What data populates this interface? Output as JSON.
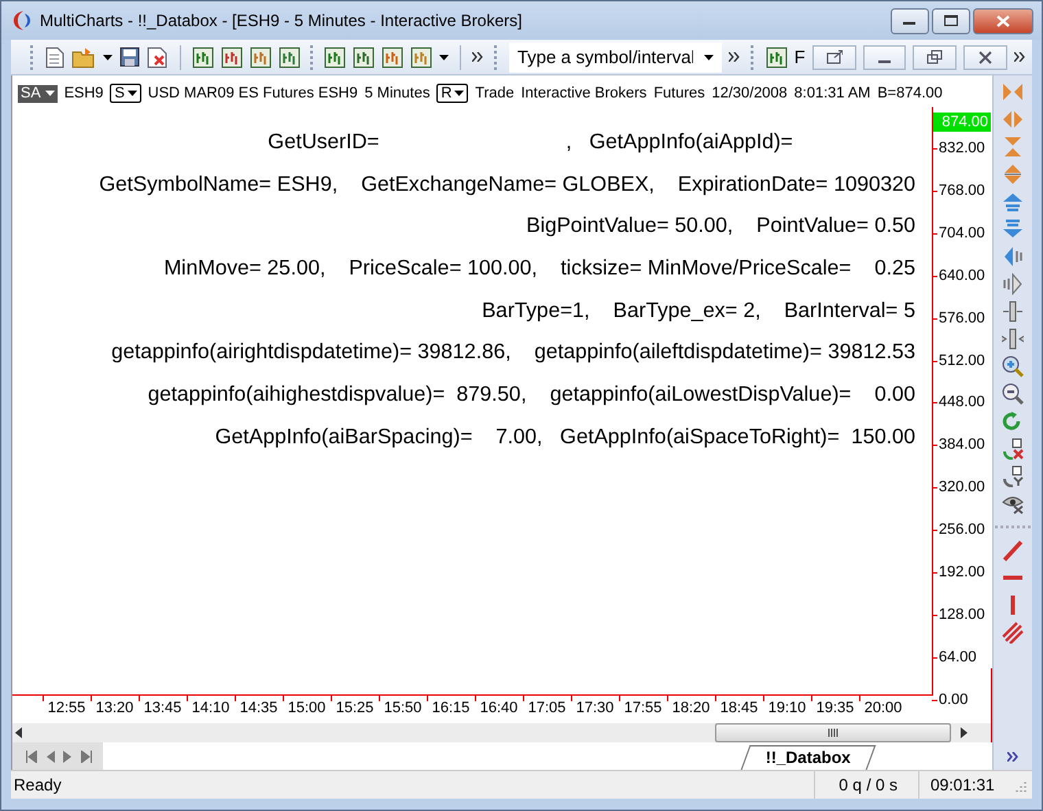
{
  "window": {
    "title": "MultiCharts - !!_Databox - [ESH9 - 5 Minutes - Interactive Brokers]"
  },
  "toolbar": {
    "symbol_field": {
      "placeholder": "Type a symbol/interval"
    },
    "f_label": "F"
  },
  "chart_header": {
    "data_series": "SA",
    "symbol": "ESH9",
    "s_button": "S",
    "description": "USD MAR09 ES Futures ESH9",
    "interval": "5 Minutes",
    "r_button": "R",
    "fields": [
      "Trade",
      "Interactive Brokers",
      "Futures",
      "12/30/2008",
      "8:01:31 AM",
      "B=874.00"
    ]
  },
  "databox_lines": [
    "GetUserID=                                ,   GetAppInfo(aiAppId)=                     ",
    "GetSymbolName= ESH9,    GetExchangeName= GLOBEX,    ExpirationDate= 1090320",
    "BigPointValue= 50.00,    PointValue= 0.50",
    "MinMove= 25.00,    PriceScale= 100.00,    ticksize= MinMove/PriceScale=    0.25",
    "BarType=1,    BarType_ex= 2,    BarInterval= 5",
    "getappinfo(airightdispdatetime)= 39812.86,    getappinfo(aileftdispdatetime)= 39812.53",
    "getappinfo(aihighestdispvalue)=  879.50,    getappinfo(aiLowestDispValue)=    0.00",
    "GetAppInfo(aiBarSpacing)=    7.00,   GetAppInfo(aiSpaceToRight)=  150.00"
  ],
  "price_axis": {
    "last_price": "874.00",
    "labels": [
      "832.00",
      "768.00",
      "704.00",
      "640.00",
      "576.00",
      "512.00",
      "448.00",
      "384.00",
      "320.00",
      "256.00",
      "192.00",
      "128.00",
      "64.00",
      "0.00"
    ]
  },
  "time_axis": {
    "labels": [
      "12:55",
      "13:20",
      "13:45",
      "14:10",
      "14:35",
      "15:00",
      "15:25",
      "15:50",
      "16:15",
      "16:40",
      "17:05",
      "17:30",
      "17:55",
      "18:20",
      "18:45",
      "19:10",
      "19:35",
      "20:00"
    ]
  },
  "tabs": [
    {
      "label": "!!_Databox",
      "selected": true
    }
  ],
  "status_bar": {
    "message": "Ready",
    "quotes": "0 q / 0 s",
    "time": "09:01:31"
  }
}
